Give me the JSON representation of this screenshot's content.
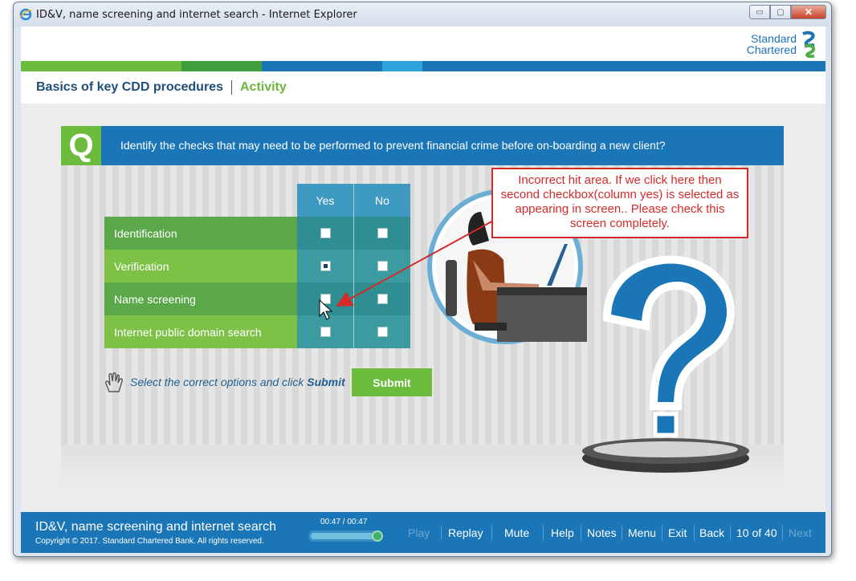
{
  "window": {
    "title": "ID&V, name screening and internet search - Internet Explorer",
    "buttons": {
      "minimize": "▭",
      "maximize": "▢",
      "close": "✕"
    }
  },
  "logo": {
    "line1": "Standard",
    "line2": "Chartered"
  },
  "stripes": [
    "#6cbb3c",
    "#3f9f3f",
    "#1a76b6",
    "#2fa4dc",
    "#1a76b6"
  ],
  "breadcrumb": {
    "course": "Basics of key CDD procedures",
    "section": "Activity"
  },
  "question": {
    "badge": "Q",
    "text": "Identify the checks that may need to be performed to prevent financial crime before on-boarding a new client?"
  },
  "table": {
    "headers": {
      "yes": "Yes",
      "no": "No"
    },
    "rows": [
      {
        "label": "Identification",
        "yes_checked": false,
        "no_checked": false
      },
      {
        "label": "Verification",
        "yes_checked": true,
        "no_checked": false
      },
      {
        "label": "Name screening",
        "yes_checked": false,
        "no_checked": false
      },
      {
        "label": "Internet public domain search",
        "yes_checked": false,
        "no_checked": false
      }
    ]
  },
  "instruction": {
    "prefix": "Select the correct options and click ",
    "emphasis": "Submit"
  },
  "submit_label": "Submit",
  "annotation": {
    "text": "Incorrect hit area. If we click here then second checkbox(column yes) is selected as appearing in screen.. Please check this screen completely."
  },
  "footer": {
    "title": "ID&V, name screening and internet search",
    "copyright": "Copyright © 2017. Standard Chartered Bank. All rights reserved.",
    "timer": "00:47 / 00:47",
    "progress": 1.0,
    "nav": {
      "play": "Play",
      "replay": "Replay",
      "mute": "Mute",
      "help": "Help",
      "notes": "Notes",
      "menu": "Menu",
      "exit": "Exit",
      "back": "Back",
      "page": "10 of 40",
      "next": "Next"
    }
  },
  "colors": {
    "brand_blue": "#1a76b6",
    "brand_green": "#6cbb3c",
    "annotation_red": "#d32a2a"
  }
}
